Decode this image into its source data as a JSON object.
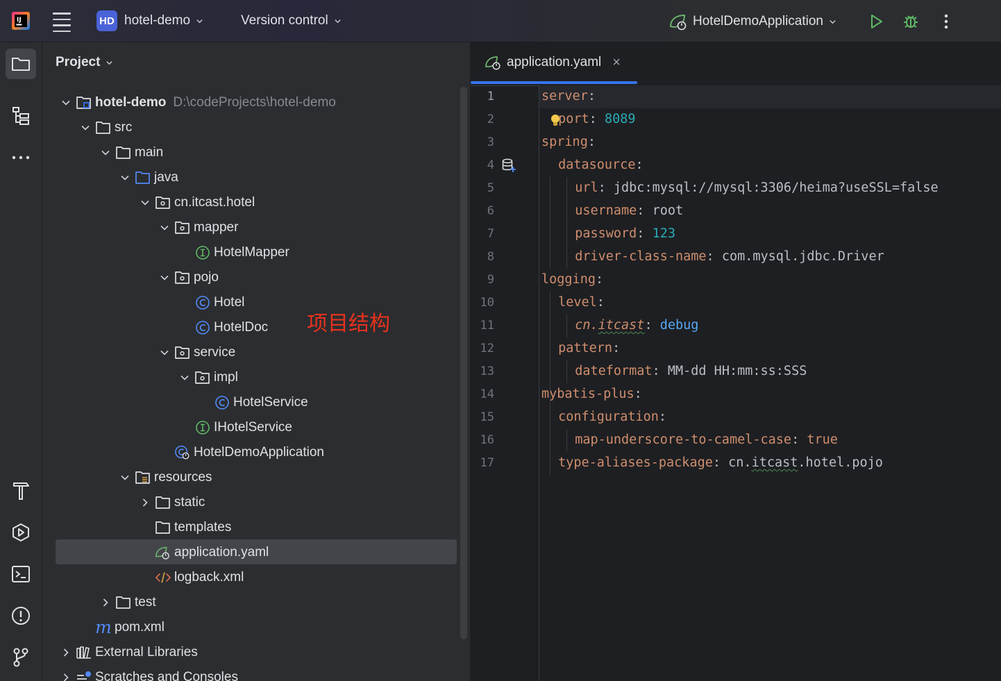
{
  "titlebar": {
    "project_badge": "HD",
    "project_name": "hotel-demo",
    "vcs_label": "Version control",
    "run_config": "HotelDemoApplication",
    "icons": [
      "intellij-logo-icon",
      "hamburger-menu-icon",
      "chevron-down-icon",
      "spring-boot-icon",
      "run-icon",
      "debug-icon",
      "more-vertical-icon"
    ]
  },
  "left_toolbar": {
    "icons": [
      "project-folder-icon",
      "structure-icon",
      "more-horizontal-icon",
      "build-hammer-icon",
      "services-icon",
      "terminal-icon",
      "problems-icon",
      "git-branch-icon"
    ]
  },
  "project_panel": {
    "title": "Project",
    "annotation": "项目结构",
    "tree": [
      {
        "label": "hotel-demo",
        "path": "D:\\codeProjects\\hotel-demo",
        "bold": true
      },
      {
        "label": "src"
      },
      {
        "label": "main"
      },
      {
        "label": "java"
      },
      {
        "label": "cn.itcast.hotel"
      },
      {
        "label": "mapper"
      },
      {
        "label": "HotelMapper"
      },
      {
        "label": "pojo"
      },
      {
        "label": "Hotel"
      },
      {
        "label": "HotelDoc"
      },
      {
        "label": "service"
      },
      {
        "label": "impl"
      },
      {
        "label": "HotelService"
      },
      {
        "label": "IHotelService"
      },
      {
        "label": "HotelDemoApplication"
      },
      {
        "label": "resources"
      },
      {
        "label": "static"
      },
      {
        "label": "templates"
      },
      {
        "label": "application.yaml",
        "selected": true
      },
      {
        "label": "logback.xml"
      },
      {
        "label": "test"
      },
      {
        "label": "pom.xml"
      },
      {
        "label": "External Libraries"
      },
      {
        "label": "Scratches and Consoles"
      }
    ]
  },
  "editor": {
    "tab_label": "application.yaml",
    "tab_close": "×",
    "lines": [
      {
        "n": "1",
        "key": "server",
        "sep": ":",
        "val": ""
      },
      {
        "n": "2",
        "key": "port",
        "sep": ": ",
        "val": "8089"
      },
      {
        "n": "3",
        "key": "spring",
        "sep": ":",
        "val": ""
      },
      {
        "n": "4",
        "key": "datasource",
        "sep": ":",
        "val": ""
      },
      {
        "n": "5",
        "key": "url",
        "sep": ": ",
        "val": "jdbc:mysql://mysql:3306/heima?useSSL=false"
      },
      {
        "n": "6",
        "key": "username",
        "sep": ": ",
        "val": "root"
      },
      {
        "n": "7",
        "key": "password",
        "sep": ": ",
        "val": "123"
      },
      {
        "n": "8",
        "key": "driver-class-name",
        "sep": ": ",
        "val": "com.mysql.jdbc.Driver"
      },
      {
        "n": "9",
        "key": "logging",
        "sep": ":",
        "val": ""
      },
      {
        "n": "10",
        "key": "level",
        "sep": ":",
        "val": ""
      },
      {
        "n": "11",
        "key_a": "cn.",
        "key_b": "itcast",
        "sep": ": ",
        "val": "debug"
      },
      {
        "n": "12",
        "key": "pattern",
        "sep": ":",
        "val": ""
      },
      {
        "n": "13",
        "key": "dateformat",
        "sep": ": ",
        "val": "MM-dd HH:mm:ss:SSS"
      },
      {
        "n": "14",
        "key": "mybatis-plus",
        "sep": ":",
        "val": ""
      },
      {
        "n": "15",
        "key": "configuration",
        "sep": ":",
        "val": ""
      },
      {
        "n": "16",
        "key": "map-underscore-to-camel-case",
        "sep": ": ",
        "val": "true"
      },
      {
        "n": "17",
        "key": "type-aliases-package",
        "sep": ": ",
        "val_a": "cn.",
        "val_b": "itcast",
        ".": ".",
        "val_c": ".hotel.pojo"
      }
    ]
  }
}
